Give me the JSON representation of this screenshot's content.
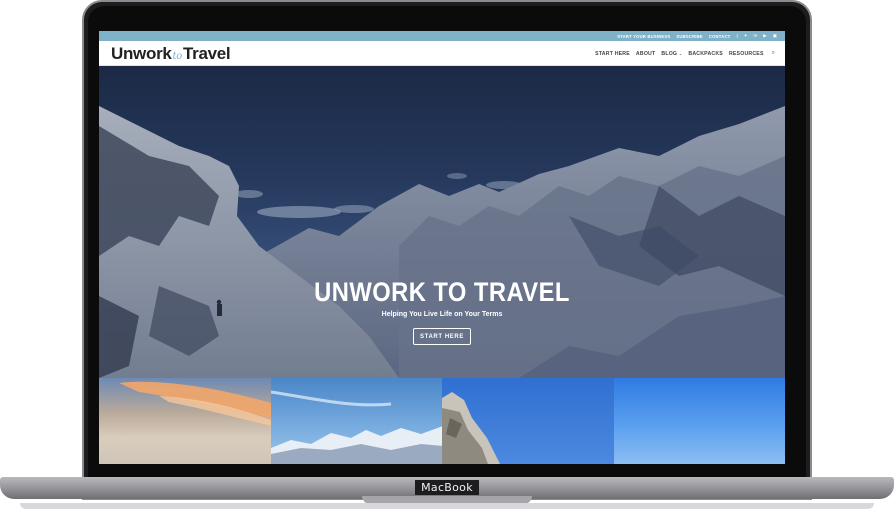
{
  "device": {
    "brand_label": "MacBook"
  },
  "topbar": {
    "links": [
      "START YOUR BUSINESS",
      "SUBSCRIBE",
      "CONTACT"
    ],
    "social_icons": [
      "facebook-icon",
      "twitter-icon",
      "email-icon",
      "youtube-icon",
      "instagram-icon"
    ],
    "color": "#7fb1c8"
  },
  "header": {
    "logo_left": "Unwork",
    "logo_mid": "to",
    "logo_right": "Travel",
    "nav": {
      "start_here": "START HERE",
      "about": "ABOUT",
      "blog": "BLOG",
      "backpacks": "BACKPACKS",
      "resources": "RESOURCES"
    }
  },
  "hero": {
    "title": "UNWORK TO TRAVEL",
    "subtitle": "Helping You Live Life on Your Terms",
    "button": "START HERE"
  },
  "tiles": [
    "sunset-sky",
    "snowy-mountains",
    "rock-cliff",
    "blue-sky"
  ]
}
